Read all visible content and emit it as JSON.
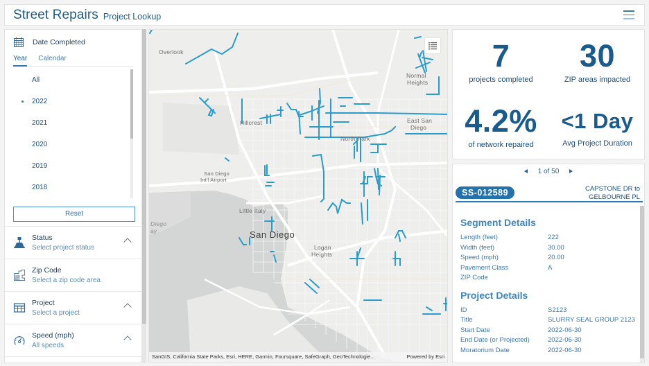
{
  "header": {
    "title": "Street Repairs",
    "subtitle": "Project Lookup",
    "menu_icon": "hamburger-menu-icon"
  },
  "filters": {
    "date": {
      "label": "Date Completed",
      "icon": "calendar-icon",
      "tabs": [
        {
          "label": "Year",
          "active": true
        },
        {
          "label": "Calendar",
          "active": false
        }
      ],
      "years": [
        {
          "label": "All",
          "selected": false
        },
        {
          "label": "2022",
          "selected": true
        },
        {
          "label": "2021",
          "selected": false
        },
        {
          "label": "2020",
          "selected": false
        },
        {
          "label": "2019",
          "selected": false
        },
        {
          "label": "2018",
          "selected": false
        }
      ],
      "reset_label": "Reset"
    },
    "items": [
      {
        "title": "Status",
        "subtitle": "Select project status",
        "icon": "road-worker-icon",
        "collapsible": true
      },
      {
        "title": "Zip Code",
        "subtitle": "Select a zip code area",
        "icon": "zip-map-icon",
        "collapsible": false
      },
      {
        "title": "Project",
        "subtitle": "Select a project",
        "icon": "table-icon",
        "collapsible": true
      },
      {
        "title": "Speed (mph)",
        "subtitle": "All speeds",
        "icon": "speedometer-icon",
        "collapsible": true
      }
    ]
  },
  "map": {
    "labels": {
      "overlook": "Overlook",
      "normal_heights_1": "Normal",
      "normal_heights_2": "Heights",
      "hillcrest": "Hillcrest",
      "east_sd_1": "East San",
      "east_sd_2": "Diego",
      "north_park": "North Park",
      "airport_1": "San Diego",
      "airport_2": "Int'l Airport",
      "little_italy": "Little Italy",
      "san_diego": "San Diego",
      "logan_1": "Logan",
      "logan_2": "Heights",
      "bay_1": "Diego",
      "bay_2": "ay"
    },
    "attribution": "SanGIS, California State Parks, Esri, HERE, Garmin, Foursquare, SafeGraph, GeoTechnologie...",
    "powered_by": "Powered by Esri",
    "legend_icon": "legend-list-icon",
    "segment_color": "#2a9ccc"
  },
  "stats": [
    {
      "value": "7",
      "label": "projects completed"
    },
    {
      "value": "30",
      "label": "ZIP areas impacted"
    },
    {
      "value": "4.2%",
      "label": "of network repaired"
    },
    {
      "value": "<1 Day",
      "label": "Avg Project Duration"
    }
  ],
  "details": {
    "pager": {
      "current": 1,
      "total": 50,
      "text": "1 of 50"
    },
    "segment_id": "SS-012589",
    "location_line1": "CAPSTONE DR to",
    "location_line2": "GELBOURNE PL",
    "segment_heading": "Segment Details",
    "segment_fields": [
      {
        "key": "Length (feet)",
        "value": "222"
      },
      {
        "key": "Width (feet)",
        "value": "30.00"
      },
      {
        "key": "Speed (mph)",
        "value": "20.00"
      },
      {
        "key": "Pavement Class",
        "value": "A"
      },
      {
        "key": "ZIP Code",
        "value": ""
      }
    ],
    "project_heading": "Project Details",
    "project_fields": [
      {
        "key": "ID",
        "value": "S2123"
      },
      {
        "key": "Title",
        "value": "SLURRY SEAL GROUP 2123"
      },
      {
        "key": "Start Date",
        "value": "2022-06-30"
      },
      {
        "key": "End Date (or Projected)",
        "value": "2022-06-30"
      },
      {
        "key": "Moratorium Date",
        "value": "2022-06-30"
      }
    ]
  },
  "colors": {
    "brand": "#1d5c87",
    "accent": "#2471ab",
    "heading": "#3e86be",
    "segment": "#2a9ccc"
  }
}
